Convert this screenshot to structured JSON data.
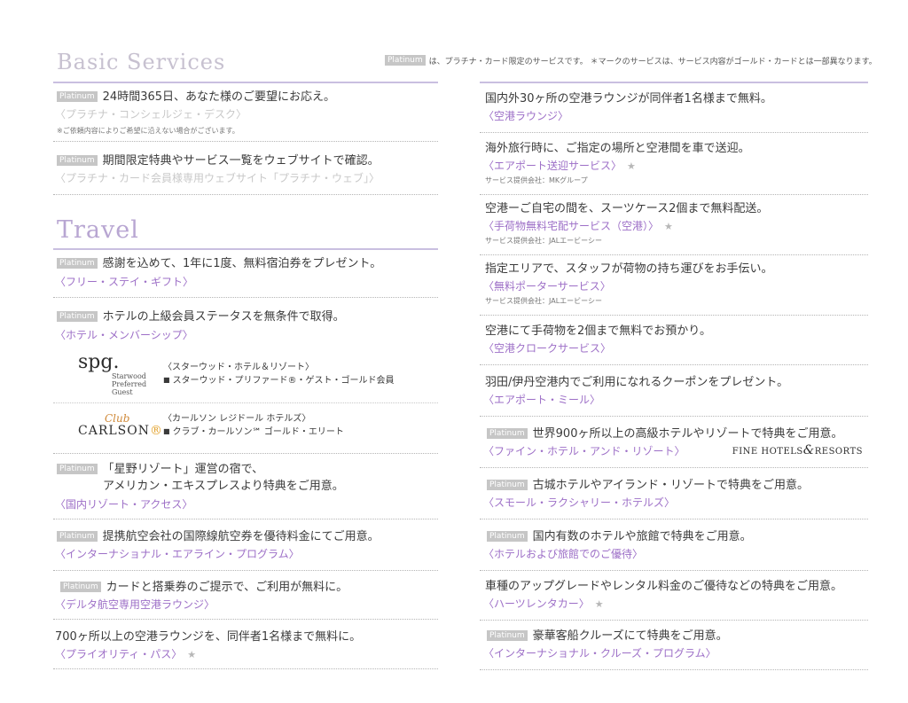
{
  "header": {
    "badge": "Platinum",
    "note": "は、プラチナ・カード限定のサービスです。 ＊マークのサービスは、サービス内容がゴールド・カードとは一部異なります。"
  },
  "basic": {
    "title": "Basic Services",
    "items": [
      {
        "text": "24時間365日、あなた様のご要望にお応え。",
        "service": "〈プラチナ・コンシェルジェ・デスク〉",
        "note": "※ご依頼内容によりご希望に沿えない場合がございます。"
      },
      {
        "text": "期間限定特典やサービス一覧をウェブサイトで確認。",
        "service": "〈プラチナ・カード会員様専用ウェブサイト「プラチナ・ウェブ」〉"
      }
    ]
  },
  "travel": {
    "title": "Travel",
    "left_items": [
      {
        "text": "感謝を込めて、1年に1度、無料宿泊券をプレゼント。",
        "service": "〈フリー・ステイ・ギフト〉"
      },
      {
        "text": "ホテルの上級会員ステータスを無条件で取得。",
        "service": "〈ホテル・メンバーシップ〉"
      },
      {
        "text1": "「星野リゾート」運営の宿で、",
        "text2": "アメリカン・エキスプレスより特典をご用意。",
        "service": "〈国内リゾート・アクセス〉"
      },
      {
        "text": "提携航空会社の国際線航空券を優待料金にてご用意。",
        "service": "〈インターナショナル・エアライン・プログラム〉"
      },
      {
        "text": "カードと搭乗券のご提示で、ご利用が無料に。",
        "service": "〈デルタ航空専用空港ラウンジ〉"
      },
      {
        "text": "700ヶ所以上の空港ラウンジを、同伴者1名様まで無料に。",
        "service": "〈プライオリティ・パス〉",
        "star": "★"
      }
    ],
    "brands": [
      {
        "logo_main": "spg.",
        "logo_sub1": "Starwood",
        "logo_sub2": "Preferred",
        "logo_sub3": "Guest",
        "name": "〈スターウッド・ホテル＆リゾート〉",
        "bullet": "■",
        "program": "スターウッド・プリファード®・ゲスト・ゴールド会員"
      },
      {
        "logo_club": "Club",
        "logo_main": "CARLSON",
        "logo_dot": "®",
        "name": "〈カールソン レジドール ホテルズ〉",
        "bullet": "■",
        "program": "クラブ・カールソン℠ ゴールド・エリート"
      }
    ],
    "right_items": [
      {
        "text": "国内外30ヶ所の空港ラウンジが同伴者1名様まで無料。",
        "service": "〈空港ラウンジ〉"
      },
      {
        "text": "海外旅行時に、ご指定の場所と空港間を車で送迎。",
        "service": "〈エアポート送迎サービス〉",
        "star": "★",
        "note": "サービス提供会社：MKグループ"
      },
      {
        "text": "空港ーご自宅の間を、スーツケース2個まで無料配送。",
        "service": "〈手荷物無料宅配サービス（空港）〉",
        "star": "★",
        "note": "サービス提供会社：JALエービーシー"
      },
      {
        "text": "指定エリアで、スタッフが荷物の持ち運びをお手伝い。",
        "service": "〈無料ポーターサービス〉",
        "note": "サービス提供会社：JALエービーシー"
      },
      {
        "text": "空港にて手荷物を2個まで無料でお預かり。",
        "service": "〈空港クロークサービス〉"
      },
      {
        "text": "羽田/伊丹空港内でご利用になれるクーポンをプレゼント。",
        "service": "〈エアポート・ミール〉"
      },
      {
        "text": "世界900ヶ所以上の高級ホテルやリゾートで特典をご用意。",
        "service": "〈ファイン・ホテル・アンド・リゾート〉",
        "logo1": "FINE HOTELS",
        "logo_amp": "&",
        "logo2": "RESORTS"
      },
      {
        "text": "古城ホテルやアイランド・リゾートで特典をご用意。",
        "service": "〈スモール・ラクシャリー・ホテルズ〉"
      },
      {
        "text": "国内有数のホテルや旅館で特典をご用意。",
        "service": "〈ホテルおよび旅館でのご優待〉"
      },
      {
        "text": "車種のアップグレードやレンタル料金のご優待などの特典をご用意。",
        "service": "〈ハーツレンタカー〉",
        "star": "★"
      },
      {
        "text": "豪華客船クルーズにて特典をご用意。",
        "service": "〈インターナショナル・クルーズ・プログラム〉"
      }
    ]
  },
  "colors": {
    "accent": "#9d6fc7",
    "rule": "#c9bfe0",
    "title": "#c7c1d0",
    "badge": "#c6c6c6"
  }
}
